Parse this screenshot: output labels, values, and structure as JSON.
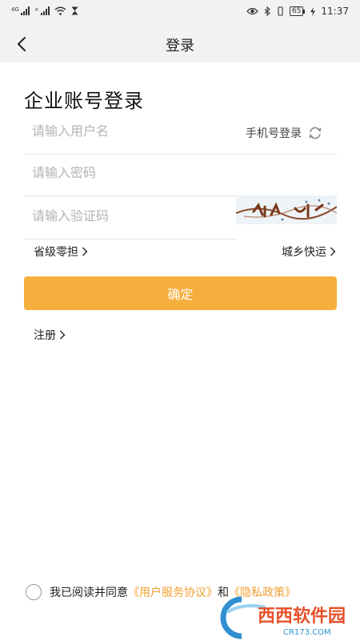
{
  "status_bar": {
    "sim1_label": "4G",
    "sim2_label": "×",
    "eye_icon": "eye-icon",
    "bluetooth_icon": "bluetooth-icon",
    "battery": "65",
    "time": "11:37"
  },
  "nav": {
    "title": "登录",
    "back_icon": "chevron-left-icon"
  },
  "page_title": "企业账号登录",
  "form": {
    "username_placeholder": "请输入用户名",
    "password_placeholder": "请输入密码",
    "captcha_placeholder": "请输入验证码",
    "phone_login_label": "手机号登录",
    "refresh_icon": "refresh-icon"
  },
  "options": {
    "left_label": "省级零担",
    "right_label": "城乡快运"
  },
  "confirm_button": "确定",
  "register_label": "注册",
  "agreement": {
    "prefix": "我已阅读并同意",
    "terms_link": "《用户服务协议》",
    "conjunction": "和",
    "privacy_link": "《隐私政策》"
  },
  "watermark": {
    "brand": "西西软件园",
    "url": "CR173.COM"
  },
  "colors": {
    "accent": "#f6ae3c",
    "link": "#f0a030",
    "background": "#f2f2f2"
  }
}
